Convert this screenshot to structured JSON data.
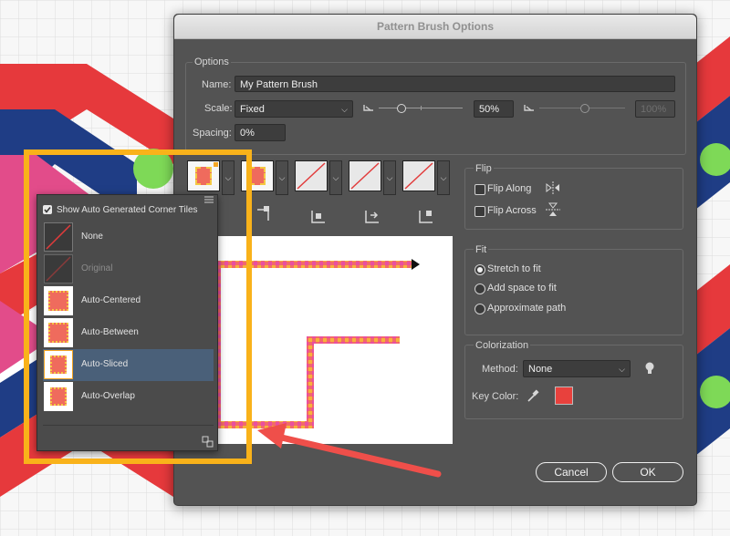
{
  "dialog": {
    "title": "Pattern Brush Options",
    "options_group": "Options",
    "name_label": "Name:",
    "name_value": "My Pattern Brush",
    "scale_label": "Scale:",
    "scale_value": "Fixed",
    "scale_percent": "50%",
    "scale_percent_disabled": "100%",
    "spacing_label": "Spacing:",
    "spacing_value": "0%",
    "flip": {
      "title": "Flip",
      "along": "Flip Along",
      "across": "Flip Across"
    },
    "fit": {
      "title": "Fit",
      "options": [
        "Stretch to fit",
        "Add space to fit",
        "Approximate path"
      ],
      "selected_index": 0
    },
    "colorization": {
      "title": "Colorization",
      "method_label": "Method:",
      "method_value": "None",
      "key_color_label": "Key Color:",
      "key_color": "#e8413d"
    },
    "cancel_label": "Cancel",
    "ok_label": "OK"
  },
  "corner_popup": {
    "show_auto_label": "Show Auto Generated Corner Tiles",
    "items": [
      {
        "label": "None"
      },
      {
        "label": "Original"
      },
      {
        "label": "Auto-Centered"
      },
      {
        "label": "Auto-Between"
      },
      {
        "label": "Auto-Sliced"
      },
      {
        "label": "Auto-Overlap"
      }
    ],
    "selected_index": 4
  },
  "colors": {
    "dialog_bg": "#535353",
    "highlight": "#f9b21a",
    "arrow": "#ef4f4a",
    "selection": "#4a6079"
  }
}
